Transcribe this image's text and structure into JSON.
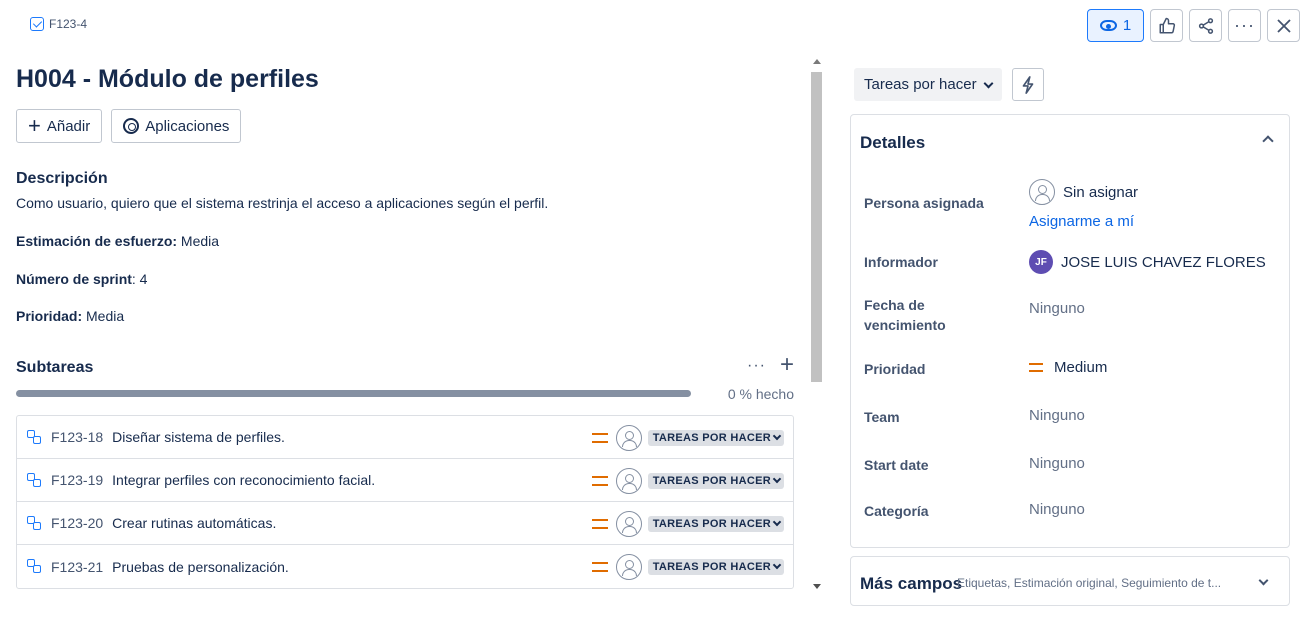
{
  "issue": {
    "key": "F123-4",
    "title": "H004 - Módulo de perfiles"
  },
  "topbar": {
    "watch_count": "1",
    "icons": [
      "eye-icon",
      "thumbs-up-icon",
      "share-icon",
      "more-icon",
      "close-icon"
    ]
  },
  "toolbar": {
    "add_label": "Añadir",
    "apps_label": "Aplicaciones"
  },
  "description": {
    "heading": "Descripción",
    "text": "Como usuario, quiero que el sistema restrinja el acceso a aplicaciones según el perfil.",
    "effort_label": "Estimación de esfuerzo:",
    "effort_value": " Media",
    "sprint_label": "Número de sprint",
    "sprint_value": ": 4",
    "priority_label": "Prioridad:",
    "priority_value": " Media"
  },
  "subtasks": {
    "heading": "Subtareas",
    "progress_fraction": 0,
    "progress_text": "0 % hecho",
    "items": [
      {
        "key": "F123-18",
        "summary": "Diseñar sistema de perfiles.",
        "status": "TAREAS POR HACER"
      },
      {
        "key": "F123-19",
        "summary": "Integrar perfiles con reconocimiento facial.",
        "status": "TAREAS POR HACER"
      },
      {
        "key": "F123-20",
        "summary": "Crear rutinas automáticas.",
        "status": "TAREAS POR HACER"
      },
      {
        "key": "F123-21",
        "summary": "Pruebas de personalización.",
        "status": "TAREAS POR HACER"
      }
    ]
  },
  "sidebar": {
    "status_label": "Tareas por hacer",
    "details": {
      "heading": "Detalles",
      "assignee_label": "Persona asignada",
      "assignee_value": "Sin asignar",
      "assign_me": "Asignarme a mí",
      "reporter_label": "Informador",
      "reporter_initials": "JF",
      "reporter_value": "JOSE LUIS CHAVEZ FLORES",
      "due_label": "Fecha de vencimiento",
      "due_value": "Ninguno",
      "priority_label": "Prioridad",
      "priority_value": "Medium",
      "team_label": "Team",
      "team_value": "Ninguno",
      "start_label": "Start date",
      "start_value": "Ninguno",
      "category_label": "Categoría",
      "category_value": "Ninguno"
    },
    "more_fields": {
      "heading": "Más campos",
      "summary": "Etiquetas, Estimación original, Seguimiento de t..."
    }
  },
  "colors": {
    "accent": "#0c66e4",
    "priority_medium": "#e06c00",
    "reporter_avatar": "#5e4db2"
  }
}
